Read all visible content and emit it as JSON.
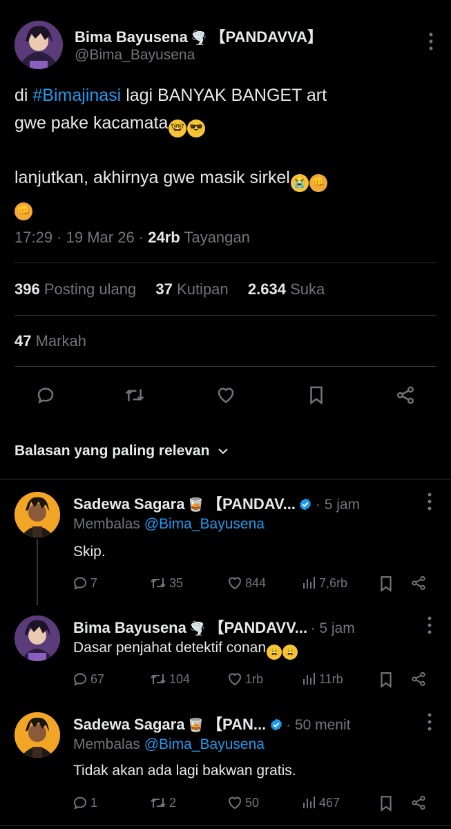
{
  "main_post": {
    "display_name": "Bima Bayusena",
    "name_suffix": "【PANDAVVA】",
    "name_emoji": "🌪️",
    "handle": "@Bima_Bayusena",
    "text_prefix": "di ",
    "hashtag": "#Bimajinasi",
    "text_line1_rest": " lagi BANYAK BANGET art",
    "text_line2": "gwe pake kacamata",
    "text_line3": "lanjutkan, akhirnya gwe masik sirkel",
    "emoji_nerd": "🤓",
    "emoji_cool": "😎",
    "emoji_cry": "😭",
    "emoji_fist": "👊",
    "time": "17:29",
    "date": "19 Mar 26",
    "views_count": "24rb",
    "views_label": "Tayangan",
    "reposts_count": "396",
    "reposts_label": "Posting ulang",
    "quotes_count": "37",
    "quotes_label": "Kutipan",
    "likes_count": "2.634",
    "likes_label": "Suka",
    "bookmarks_count": "47",
    "bookmarks_label": "Markah"
  },
  "replies_header": {
    "label": "Balasan yang paling relevan"
  },
  "replies": [
    {
      "display_name": "Sadewa Sagara",
      "name_emoji": "🥃",
      "name_suffix": "【PANDAV...",
      "verified": true,
      "time": "5 jam",
      "replying_label": "Membalas ",
      "replying_handle": "@Bima_Bayusena",
      "text": "Skip.",
      "comments": "7",
      "reposts": "35",
      "likes": "844",
      "views": "7,6rb"
    },
    {
      "display_name": "Bima Bayusena",
      "name_emoji": "🌪️",
      "name_suffix": "【PANDAVV...",
      "verified": false,
      "time": "5 jam",
      "text": "Dasar penjahat detektif conan",
      "emoji_a": "😩",
      "emoji_b": "😩",
      "comments": "67",
      "reposts": "104",
      "likes": "1rb",
      "views": "11rb"
    },
    {
      "display_name": "Sadewa Sagara",
      "name_emoji": "🥃",
      "name_suffix": "【PAN...",
      "verified": true,
      "time": "50 menit",
      "replying_label": "Membalas ",
      "replying_handle": "@Bima_Bayusena",
      "text": "Tidak akan ada lagi bakwan gratis.",
      "comments": "1",
      "reposts": "2",
      "likes": "50",
      "views": "467"
    }
  ],
  "colors": {
    "background": "#000000",
    "text": "#e7e9ea",
    "muted": "#71767b",
    "link": "#1d9bf0",
    "divider": "#2f3336"
  }
}
